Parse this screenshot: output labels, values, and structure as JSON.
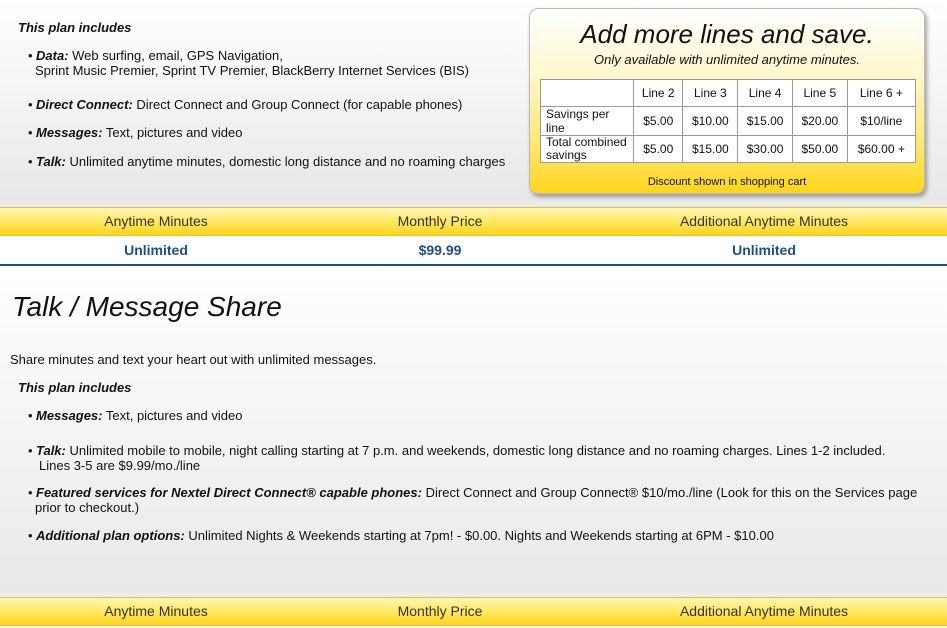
{
  "plan1": {
    "includes_heading": "This plan includes",
    "features": [
      {
        "label": "Data:",
        "text": "Web surfing, email, GPS Navigation,",
        "text2": "Sprint Music Premier, Sprint TV Premier, BlackBerry Internet Services (BIS)"
      },
      {
        "label": "Direct Connect:",
        "text": "Direct Connect and Group Connect (for capable phones)"
      },
      {
        "label": "Messages:",
        "text": "Text, pictures and video"
      },
      {
        "label": "Talk:",
        "text": "Unlimited anytime minutes, domestic long distance and no roaming charges"
      }
    ]
  },
  "promo": {
    "title": "Add more lines and save.",
    "subtitle": "Only available with unlimited anytime minutes.",
    "columns": [
      "",
      "Line 2",
      "Line 3",
      "Line 4",
      "Line 5",
      "Line 6 +"
    ],
    "rows": [
      {
        "label": "Savings per line",
        "values": [
          "$5.00",
          "$10.00",
          "$15.00",
          "$20.00",
          "$10/line"
        ]
      },
      {
        "label": "Total combined savings",
        "values": [
          "$5.00",
          "$15.00",
          "$30.00",
          "$50.00",
          "$60.00 +"
        ]
      }
    ],
    "footer": "Discount shown in shopping cart"
  },
  "pricing_headers": [
    "Anytime Minutes",
    "Monthly Price",
    "Additional Anytime Minutes"
  ],
  "pricing_values": [
    "Unlimited",
    "$99.99",
    "Unlimited"
  ],
  "plan2": {
    "title": "Talk / Message Share",
    "intro": "Share minutes and text your heart out with unlimited messages.",
    "includes_heading": "This plan includes",
    "features": [
      {
        "label": "Messages:",
        "text": "Text, pictures and video"
      },
      {
        "label": "Talk:",
        "text": "Unlimited mobile to mobile, night calling starting at 7 p.m. and weekends, domestic long distance and no roaming charges.  Lines 1-2 included.",
        "text2": "Lines 3-5 are $9.99/mo./line"
      },
      {
        "label": "Featured services for Nextel Direct Connect® capable phones:",
        "text": "Direct Connect and Group Connect® $10/mo./line (Look for this on the Services page",
        "text2": "prior to checkout.)"
      },
      {
        "label": "Additional plan options:",
        "text": "Unlimited Nights & Weekends starting at 7pm! - $0.00.  Nights and Weekends starting at 6PM - $10.00"
      }
    ]
  },
  "pricing_headers_2": [
    "Anytime Minutes",
    "Monthly Price",
    "Additional Anytime Minutes"
  ]
}
